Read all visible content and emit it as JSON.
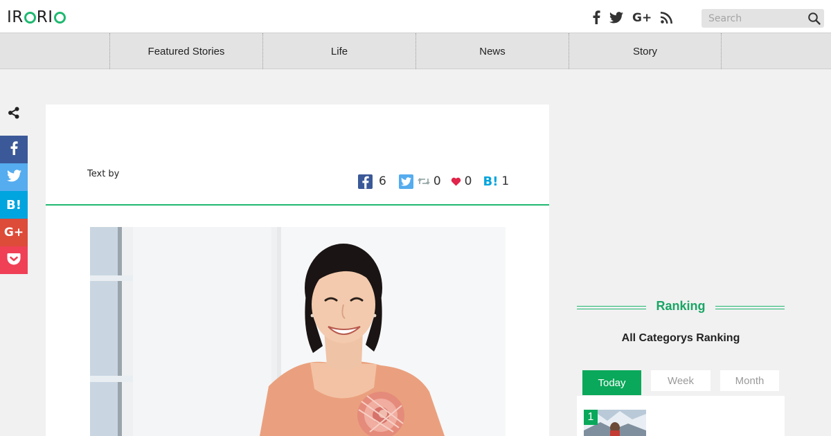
{
  "header": {
    "logo_text": "IRORIO",
    "social_icons": [
      "facebook-icon",
      "twitter-icon",
      "google-plus-icon",
      "rss-icon"
    ],
    "search": {
      "placeholder": "Search",
      "value": ""
    }
  },
  "nav": {
    "items": [
      {
        "label": "Featured Stories"
      },
      {
        "label": "Life"
      },
      {
        "label": "News"
      },
      {
        "label": "Story"
      }
    ]
  },
  "share_bar": {
    "buttons": [
      {
        "icon": "facebook-icon",
        "color": "#3b5998"
      },
      {
        "icon": "twitter-icon",
        "color": "#55acee"
      },
      {
        "icon": "hatena-bookmark-icon",
        "label": "B!",
        "color": "#00a4de"
      },
      {
        "icon": "google-plus-icon",
        "label": "G+",
        "color": "#dd4b39"
      },
      {
        "icon": "pocket-icon",
        "color": "#ef4056"
      }
    ]
  },
  "article": {
    "text_by": "Text by",
    "counts": {
      "facebook": "6",
      "retweet": "0",
      "like": "0",
      "hatena": "1"
    }
  },
  "sidebar": {
    "ranking_title": "Ranking",
    "ranking_subtitle": "All Categorys Ranking",
    "tabs": [
      {
        "label": "Today",
        "active": true
      },
      {
        "label": "Week",
        "active": false
      },
      {
        "label": "Month",
        "active": false
      }
    ],
    "items": [
      {
        "rank": "1"
      }
    ]
  },
  "colors": {
    "accent_green": "#1fb870",
    "tab_active": "#0aa85a",
    "facebook": "#3b5998",
    "twitter": "#55acee"
  }
}
